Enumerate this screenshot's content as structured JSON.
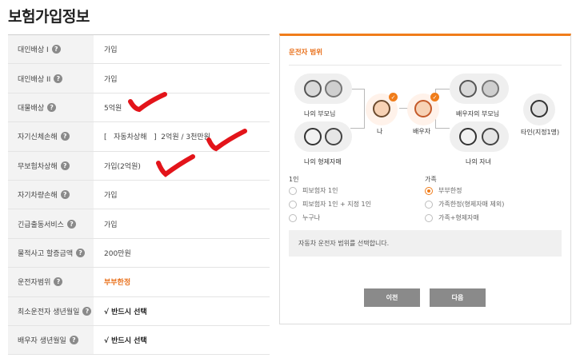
{
  "page_title": "보험가입정보",
  "help_icon_glyph": "?",
  "rows": [
    {
      "label": "대인배상 I",
      "value": "가입"
    },
    {
      "label": "대인배상 II",
      "value": "가입"
    },
    {
      "label": "대물배상",
      "value": "5억원"
    },
    {
      "label": "자기신체손해",
      "value": "[   자동차상해   ]  2억원 / 3천만원"
    },
    {
      "label": "무보험차상해",
      "value": "가입(2억원)"
    },
    {
      "label": "자기차량손해",
      "value": "가입"
    },
    {
      "label": "긴급출동서비스",
      "value": "가입"
    },
    {
      "label": "물적사고 할증금액",
      "value": "200만원"
    },
    {
      "label": "운전자범위",
      "value": "부부한정"
    },
    {
      "label": "최소운전자 생년월일",
      "value": "√ 반드시 선택"
    },
    {
      "label": "배우자 생년월일",
      "value": "√ 반드시 선택"
    }
  ],
  "panel": {
    "title": "운전자 범위",
    "people": {
      "my_parents": "나의 부모님",
      "my_siblings": "나의 형제자매",
      "me": "나",
      "spouse": "배우자",
      "spouse_parents": "배우자의 부모님",
      "my_children": "나의 자녀",
      "other": "타인(지정1명)"
    },
    "check_glyph": "✓",
    "group_one": {
      "title": "1인",
      "options": [
        "피보험자 1인",
        "피보험자 1인 + 지정 1인",
        "누구나"
      ]
    },
    "group_family": {
      "title": "가족",
      "options": [
        "부부한정",
        "가족한정(형제자매 제외)",
        "가족+형제자매"
      ],
      "selected_index": 0
    },
    "info_text": "자동차 운전자 범위를 선택합니다.",
    "prev_label": "이전",
    "next_label": "다음"
  },
  "colors": {
    "accent": "#f07d1b",
    "red_mark": "#e3141a"
  }
}
